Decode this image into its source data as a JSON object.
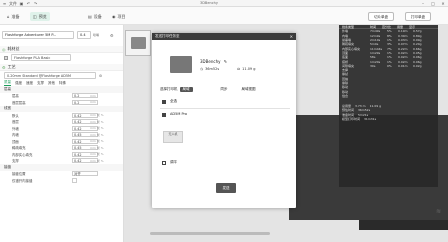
{
  "window": {
    "title": "3DBenchy",
    "file_label": "文件"
  },
  "tabs": [
    {
      "label": "准备",
      "icon": "home-icon"
    },
    {
      "label": "预览",
      "icon": "preview-icon"
    },
    {
      "label": "设备",
      "icon": "device-icon"
    },
    {
      "label": "项目",
      "icon": "project-icon"
    }
  ],
  "toolbar_right": {
    "slice_label": "切片单盘",
    "print_label": "打印单盘"
  },
  "sidebar": {
    "printer_label": "Flashforge Adventurer 5M P...",
    "nozzle_label": "0.4",
    "nozzle_unit": "喷嘴",
    "filament_section": "耗材丝",
    "filament_value": "Flashforge PLA Basic",
    "process_section": "工艺",
    "process_value": "0.20mm Standard @Flashforge AD5M",
    "small_tabs": [
      "质量",
      "强度",
      "速度",
      "支撑",
      "其他",
      "特殊"
    ],
    "categories": [
      {
        "name": "层高",
        "rows": [
          {
            "label": "层高",
            "value": "0.2",
            "unit": "mm"
          },
          {
            "label": "首层层高",
            "value": "0.2",
            "unit": "mm"
          }
        ]
      },
      {
        "name": "线宽",
        "rows": [
          {
            "label": "默认",
            "value": "0.42",
            "unit": "mm 或 %"
          },
          {
            "label": "首层",
            "value": "0.42",
            "unit": "mm 或 %"
          },
          {
            "label": "外墙",
            "value": "0.42",
            "unit": "mm 或 %"
          },
          {
            "label": "内墙",
            "value": "0.45",
            "unit": "mm 或 %"
          },
          {
            "label": "顶面",
            "value": "0.42",
            "unit": "mm 或 %"
          },
          {
            "label": "稀疏填充",
            "value": "0.45",
            "unit": "mm 或 %"
          },
          {
            "label": "内部实心填充",
            "value": "0.42",
            "unit": "mm 或 %"
          },
          {
            "label": "支撑",
            "value": "0.42",
            "unit": "mm 或 %"
          }
        ]
      },
      {
        "name": "接缝",
        "rows": [
          {
            "label": "接缝位置",
            "value": "对齐",
            "unit": ""
          },
          {
            "label": "仅错开内接缝",
            "value": "",
            "unit": ""
          }
        ]
      }
    ]
  },
  "stats_overlay": {
    "headers": [
      "线条类型",
      "时间",
      "百分比",
      "用量",
      "显示"
    ],
    "rows": [
      {
        "name": "外墙",
        "time": "7m49s",
        "pct": "5%",
        "usage": "0.19m",
        "g": "0.57g"
      },
      {
        "name": "内墙",
        "time": "12m9s",
        "pct": "8%",
        "usage": "0.30m",
        "g": "0.89g"
      },
      {
        "name": "悬垂墙",
        "time": "2m10s",
        "pct": "1%",
        "usage": "0.03m",
        "g": "0.09g"
      },
      {
        "name": "稀疏填充",
        "time": "5m0s",
        "pct": "3%",
        "usage": "0.07m",
        "g": "0.20g"
      },
      {
        "name": "内部实心填充",
        "time": "11m44s",
        "pct": "7%",
        "usage": "0.22m",
        "g": "0.66g"
      },
      {
        "name": "顶面",
        "time": "1m29s",
        "pct": "1%",
        "usage": "0.02m",
        "g": "0.05g"
      },
      {
        "name": "底面",
        "time": "58s",
        "pct": "1%",
        "usage": "0.02m",
        "g": "0.06g"
      },
      {
        "name": "搭桥",
        "time": "1m20s",
        "pct": "1%",
        "usage": "0.02m",
        "g": "0.06g"
      },
      {
        "name": "间隙填充",
        "time": "30s",
        "pct": "0%",
        "usage": "0.01m",
        "g": "0.02g"
      }
    ],
    "extra_labels": [
      "支撑",
      "擦拭",
      "回抽",
      "擦除",
      "移动",
      "移动",
      "缝合"
    ],
    "summary": [
      {
        "label": "总用量",
        "value": "3.73 m",
        "g": "11.09 g"
      },
      {
        "label": "预估时间",
        "value": "36m52s"
      },
      {
        "label": "准备时间",
        "value": "5m21s"
      },
      {
        "label": "模型打印时间",
        "value": "31m31s"
      }
    ]
  },
  "dialog": {
    "title": "发送打印任务至",
    "close": "✕",
    "model_name": "3DBenchy",
    "time": "36m52s",
    "weight": "11.09 g",
    "select_printer": "选择打印机",
    "printer_tag": "局域",
    "tab_sync": "同步",
    "tab_sync_all": "局域视图",
    "check_all": "全选",
    "printer_name": "AD5M Pro",
    "gray_btn_text": "无人机",
    "leveling": "调平",
    "send_label": "发送"
  },
  "colors": {
    "accent": "#1b9e5b",
    "dark_panel": "#2f2f2f",
    "plate": "#3a3a3a"
  }
}
